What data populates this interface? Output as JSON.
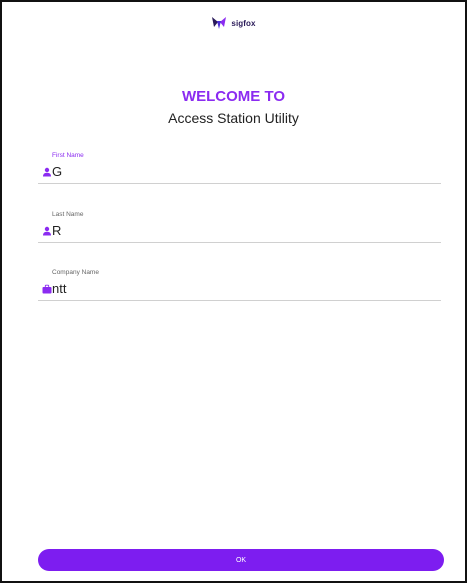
{
  "brand": {
    "name": "sigfox"
  },
  "header": {
    "welcome": "WELCOME TO",
    "subtitle": "Access Station Utility"
  },
  "form": {
    "first_name": {
      "label": "First Name",
      "value": "G",
      "icon": "person-icon"
    },
    "last_name": {
      "label": "Last Name",
      "value": "R",
      "icon": "person-icon"
    },
    "company_name": {
      "label": "Company Name",
      "value": "ntt",
      "icon": "briefcase-icon"
    }
  },
  "actions": {
    "ok_label": "OK"
  },
  "colors": {
    "accent": "#8b2bf1",
    "button": "#7d1df0",
    "logo": "#2a1a59"
  }
}
